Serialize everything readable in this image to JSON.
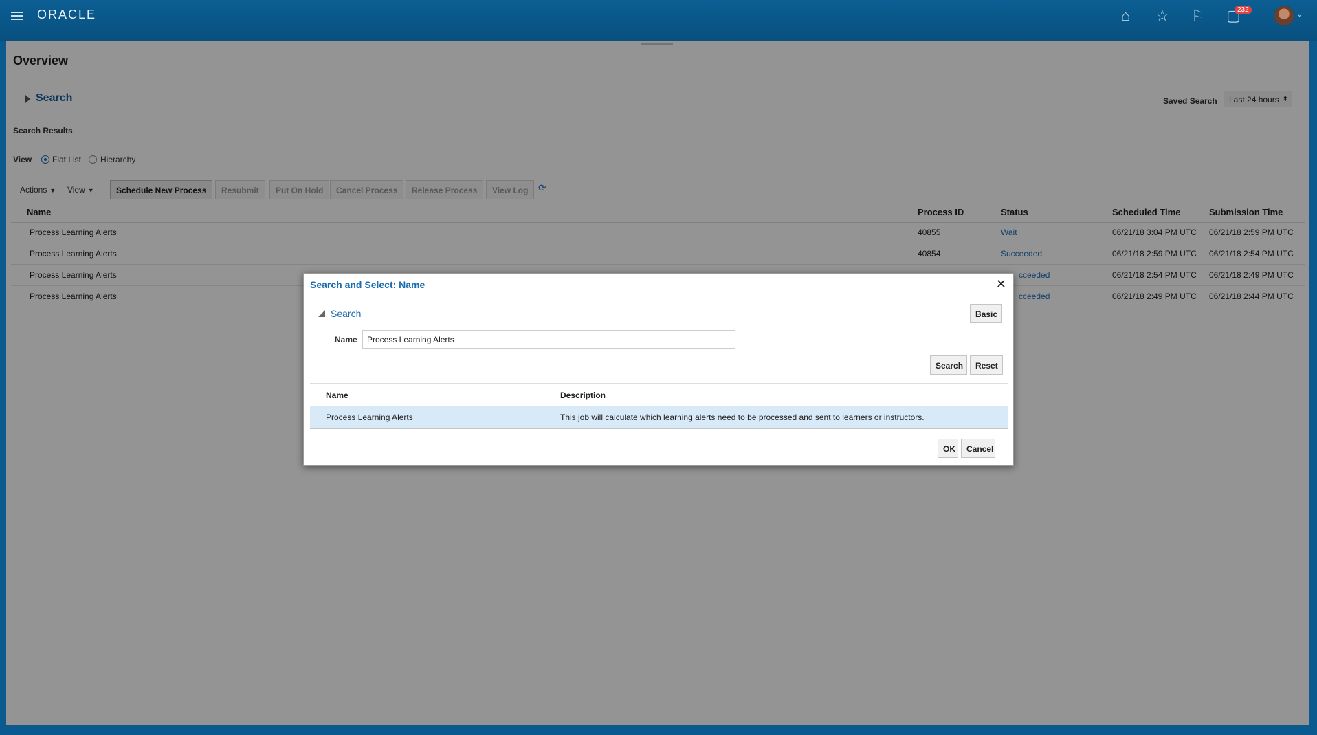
{
  "header": {
    "logo": "ORACLE",
    "notification_count": "232",
    "icons": [
      "hamburger-icon",
      "home-icon",
      "star-icon",
      "flag-icon",
      "chat-icon",
      "avatar"
    ]
  },
  "page": {
    "title": "Overview",
    "search_label": "Search",
    "saved_search_label": "Saved Search",
    "saved_search_value": "Last 24 hours",
    "results_title": "Search Results",
    "view_label": "View",
    "view_options": [
      "Flat List",
      "Hierarchy"
    ],
    "view_selected": "Flat List"
  },
  "toolbar": {
    "actions": "Actions",
    "view": "View",
    "schedule": "Schedule New Process",
    "resubmit": "Resubmit",
    "put_on_hold": "Put On Hold",
    "cancel_process": "Cancel Process",
    "release_process": "Release Process",
    "view_log": "View Log"
  },
  "table": {
    "columns": [
      "Name",
      "Process ID",
      "Status",
      "Scheduled Time",
      "Submission Time"
    ],
    "rows": [
      {
        "name": "Process Learning Alerts",
        "id": "40855",
        "status": "Wait",
        "scheduled": "06/21/18 3:04 PM UTC",
        "submitted": "06/21/18 2:59 PM UTC"
      },
      {
        "name": "Process Learning Alerts",
        "id": "40854",
        "status": "Succeeded",
        "scheduled": "06/21/18 2:59 PM UTC",
        "submitted": "06/21/18 2:54 PM UTC"
      },
      {
        "name": "Process Learning Alerts",
        "id": "",
        "status": "cceeded",
        "scheduled": "06/21/18 2:54 PM UTC",
        "submitted": "06/21/18 2:49 PM UTC"
      },
      {
        "name": "Process Learning Alerts",
        "id": "",
        "status": "cceeded",
        "scheduled": "06/21/18 2:49 PM UTC",
        "submitted": "06/21/18 2:44 PM UTC"
      }
    ]
  },
  "dialog": {
    "title": "Search and Select: Name",
    "search_label": "Search",
    "basic_button": "Basic",
    "name_label": "Name",
    "name_value": "Process Learning Alerts",
    "search_button": "Search",
    "reset_button": "Reset",
    "columns": [
      "Name",
      "Description"
    ],
    "result": {
      "name": "Process Learning Alerts",
      "description": "This job will calculate which learning alerts need to be processed and sent to learners or instructors."
    },
    "ok_button": "OK",
    "cancel_button": "Cancel"
  },
  "colors": {
    "header_bg": "#0c5e93",
    "link": "#1a6cae",
    "selected_row": "#d8e9f7",
    "badge": "#dd4444"
  }
}
